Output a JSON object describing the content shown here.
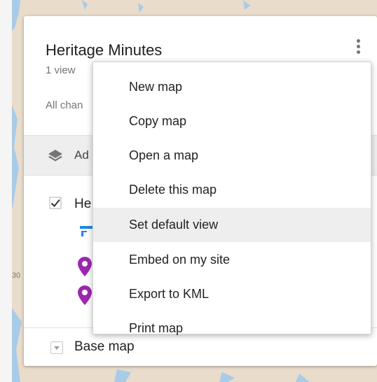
{
  "map": {
    "title": "Heritage Minutes",
    "view_count": "1 view",
    "changes_text": "All chan"
  },
  "toolbar": {
    "add_layer_label": "Ad"
  },
  "layer": {
    "name": "He",
    "checked": true
  },
  "base_map": {
    "label": "Base map"
  },
  "menu": {
    "items": [
      {
        "label": "New map"
      },
      {
        "label": "Copy map"
      },
      {
        "label": "Open a map"
      },
      {
        "label": "Delete this map"
      },
      {
        "label": "Set default view",
        "active": true
      },
      {
        "label": "Embed on my site"
      },
      {
        "label": "Export to KML"
      },
      {
        "label": "Print map"
      }
    ]
  },
  "map_label": "30",
  "colors": {
    "pin": "#9c27b0",
    "style_icon": "#1e88e5",
    "map_land": "#e9dccb",
    "map_water": "#a8cbe8"
  },
  "icons": [
    "more-vert-icon",
    "layers-icon",
    "checkbox-icon",
    "style-icon",
    "pin-icon",
    "dropdown-toggle-icon"
  ]
}
